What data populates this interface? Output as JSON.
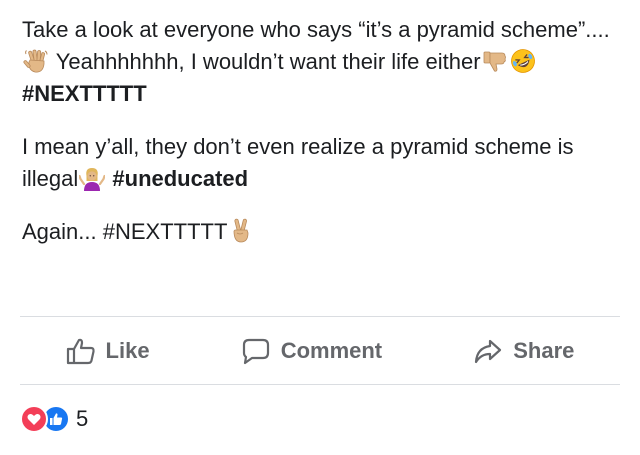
{
  "post": {
    "p1": {
      "a": "Take a look at everyone who says “it’s a pyramid scheme”.... ",
      "b": " Yeahhhhhhh, I wouldn’t want their life either",
      "c": " ",
      "hashtag": "#NEXTTTTT"
    },
    "p2": {
      "a": "I mean y’all, they don’t even realize a pyramid scheme is illegal",
      "c": " ",
      "hashtag": "#uneducated"
    },
    "p3": {
      "a": "Again... #NEXTTTTT"
    },
    "emojis": [
      "waving-hand-icon",
      "thumbs-down-icon",
      "rolling-laughing-face-icon",
      "shrugging-woman-icon",
      "victory-hand-icon"
    ]
  },
  "actions": {
    "like": "Like",
    "comment": "Comment",
    "share": "Share"
  },
  "reactions": {
    "count": "5",
    "types": [
      "love-react-icon",
      "like-react-icon"
    ],
    "colors": {
      "love": "#f33e58",
      "like": "#1877f2"
    }
  },
  "colors": {
    "text": "#1c1e21",
    "muted": "#65676b",
    "divider": "#dadde1"
  }
}
